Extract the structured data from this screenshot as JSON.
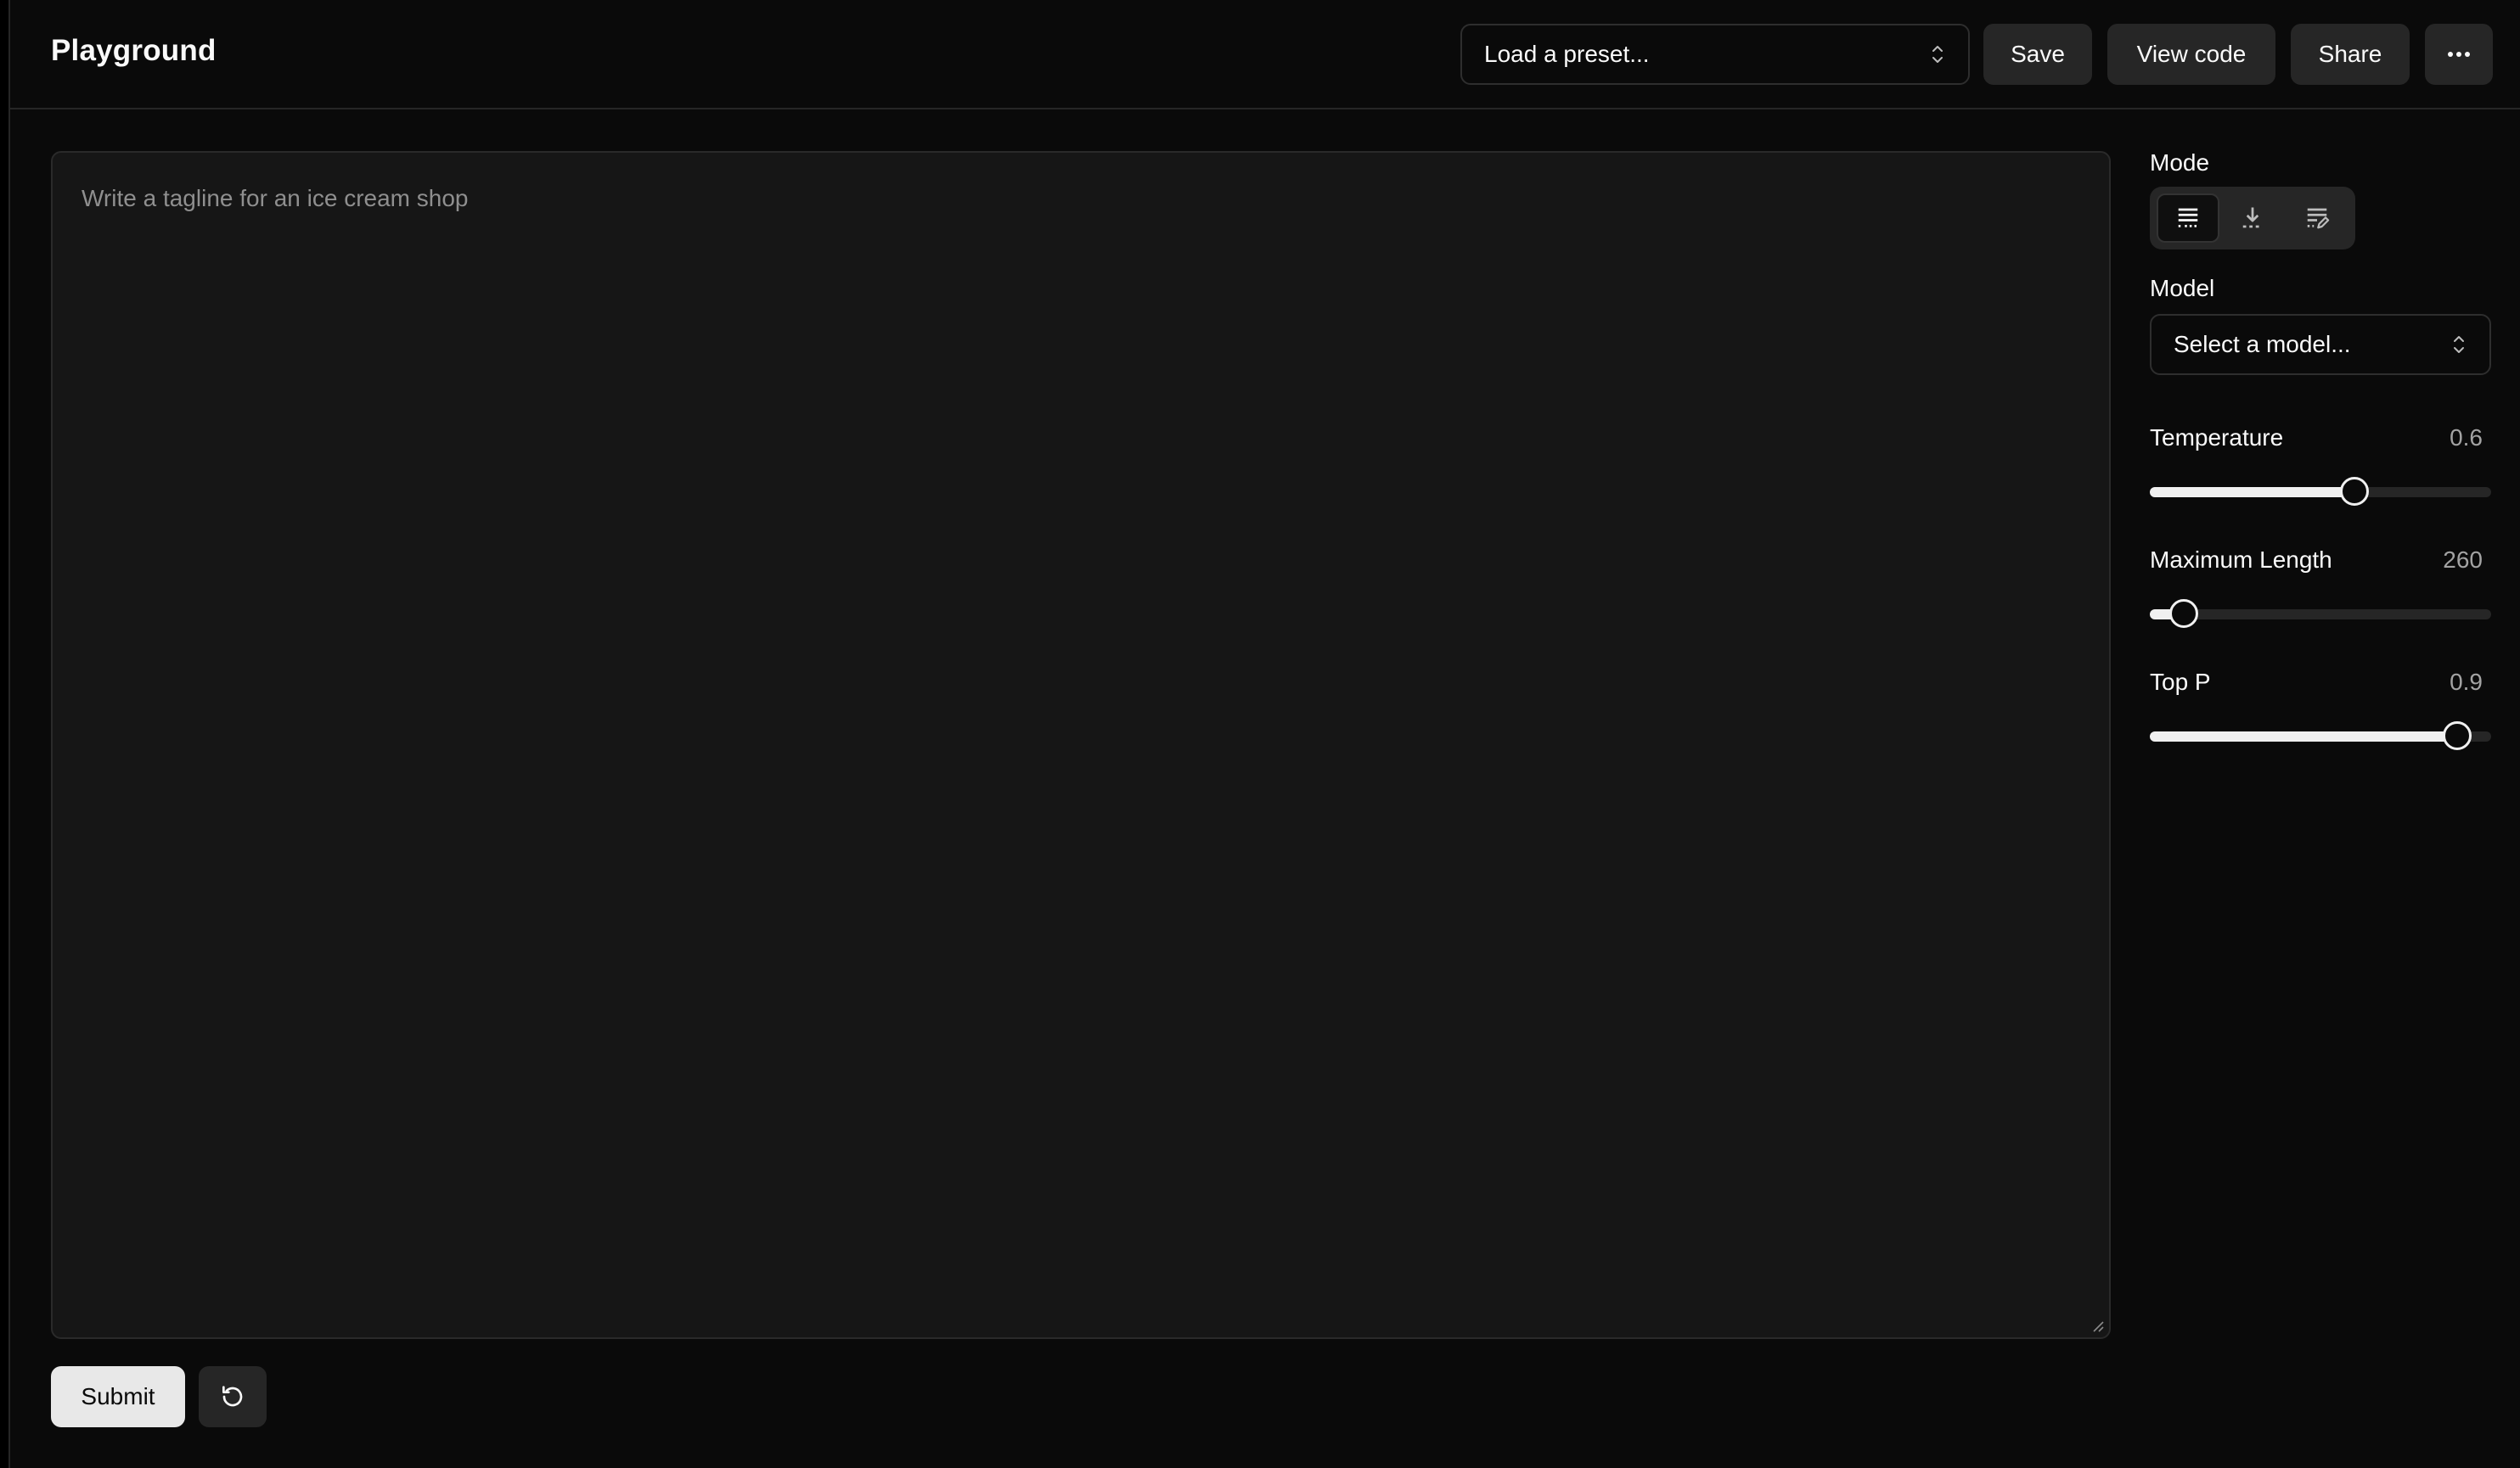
{
  "header": {
    "title": "Playground",
    "preset_placeholder": "Load a preset...",
    "save_label": "Save",
    "view_code_label": "View code",
    "share_label": "Share",
    "more_icon": "ellipsis-icon"
  },
  "editor": {
    "placeholder": "Write a tagline for an ice cream shop",
    "value": ""
  },
  "actions": {
    "submit_label": "Submit",
    "reset_icon": "reset-icon"
  },
  "sidebar": {
    "mode_label": "Mode",
    "modes": [
      {
        "icon": "complete-icon",
        "active": true
      },
      {
        "icon": "insert-icon",
        "active": false
      },
      {
        "icon": "edit-icon",
        "active": false
      }
    ],
    "model_label": "Model",
    "model_placeholder": "Select a model...",
    "temperature": {
      "label": "Temperature",
      "value": "0.6",
      "fraction": 0.6
    },
    "max_length": {
      "label": "Maximum Length",
      "value": "260",
      "fraction": 0.1
    },
    "top_p": {
      "label": "Top P",
      "value": "0.9",
      "fraction": 0.9
    }
  },
  "colors": {
    "background": "#0a0a0a",
    "panel": "#161616",
    "button": "#262626",
    "accent": "#f0f0f0"
  }
}
